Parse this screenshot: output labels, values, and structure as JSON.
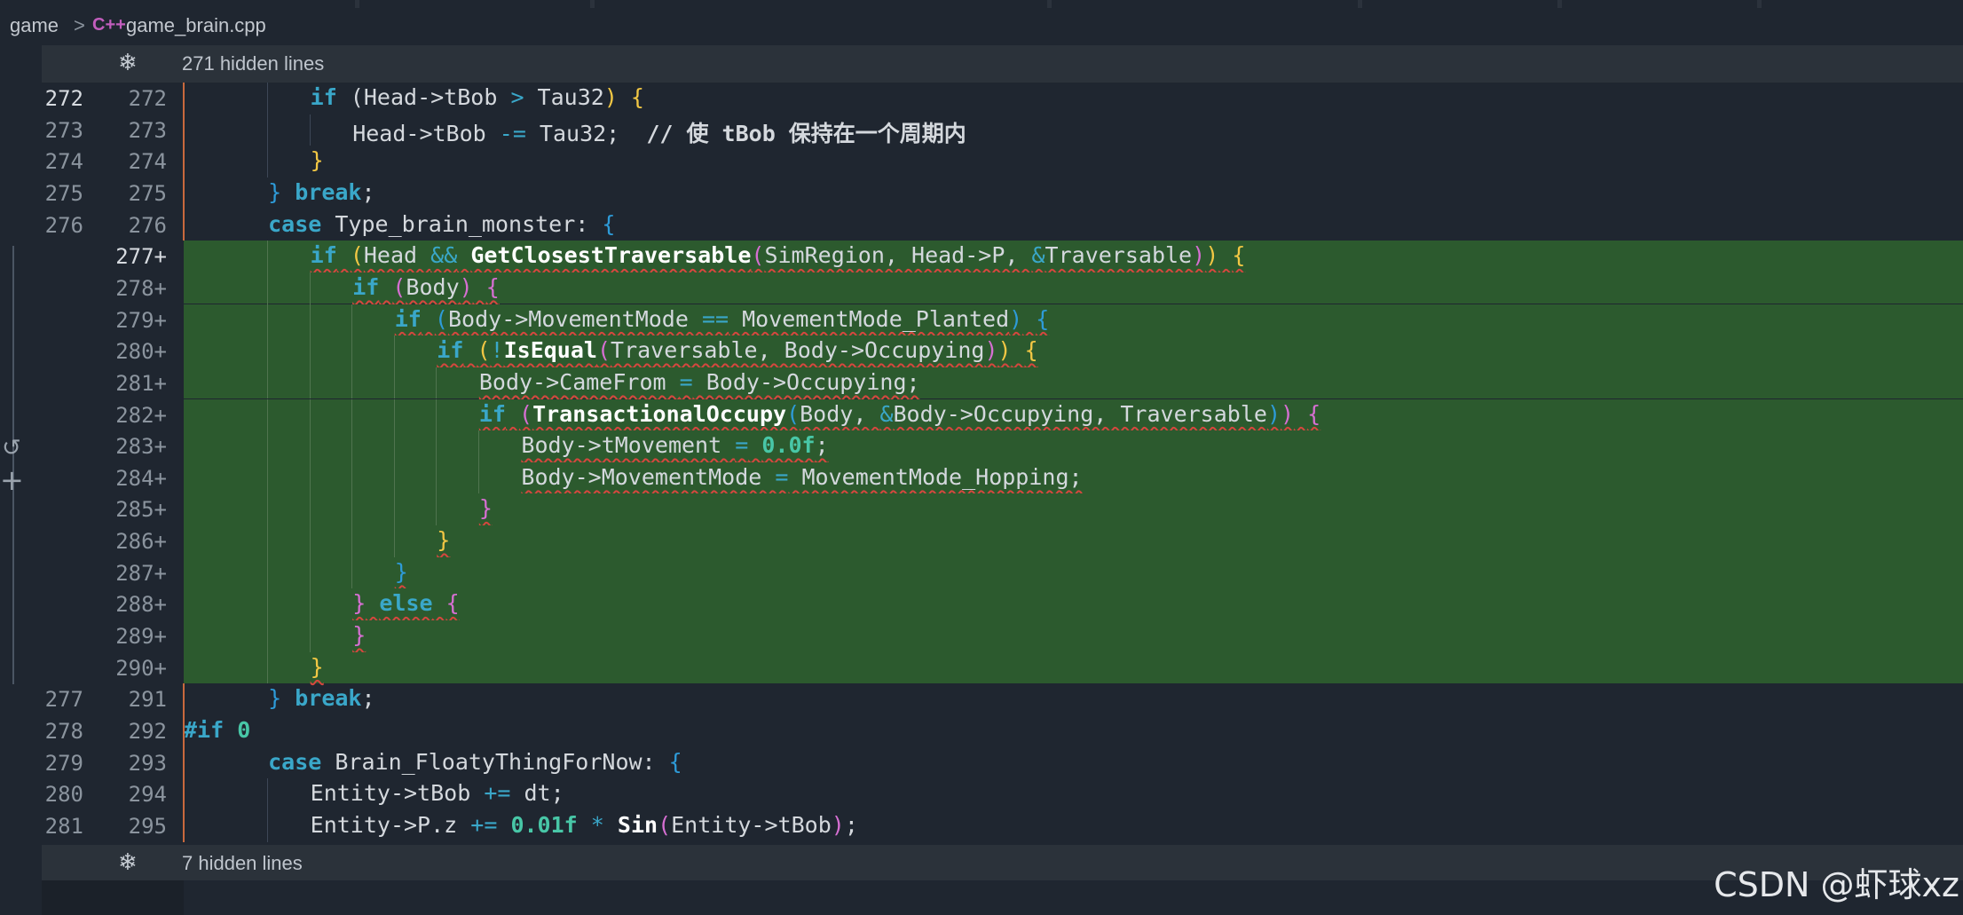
{
  "breadcrumb": {
    "folder": "game",
    "separator": ">",
    "file_icon": "C++",
    "file": "game_brain.cpp"
  },
  "hidden_top": {
    "icon": "fold-icon",
    "label": "271 hidden lines"
  },
  "hidden_bottom": {
    "icon": "fold-icon",
    "label": "7 hidden lines"
  },
  "watermark": "CSDN @虾球xz",
  "gutter_icons": {
    "revert": "↺",
    "add": "+"
  },
  "lines": [
    {
      "old": "272",
      "new": "272"
    },
    {
      "old": "273",
      "new": "273"
    },
    {
      "old": "274",
      "new": "274"
    },
    {
      "old": "275",
      "new": "275"
    },
    {
      "old": "276",
      "new": "276"
    },
    {
      "old": "",
      "new": "277+"
    },
    {
      "old": "",
      "new": "278+"
    },
    {
      "old": "",
      "new": "279+"
    },
    {
      "old": "",
      "new": "280+"
    },
    {
      "old": "",
      "new": "281+"
    },
    {
      "old": "",
      "new": "282+"
    },
    {
      "old": "",
      "new": "283+"
    },
    {
      "old": "",
      "new": "284+"
    },
    {
      "old": "",
      "new": "285+"
    },
    {
      "old": "",
      "new": "286+"
    },
    {
      "old": "",
      "new": "287+"
    },
    {
      "old": "",
      "new": "288+"
    },
    {
      "old": "",
      "new": "289+"
    },
    {
      "old": "",
      "new": "290+"
    },
    {
      "old": "277",
      "new": "291"
    },
    {
      "old": "278",
      "new": "292"
    },
    {
      "old": "279",
      "new": "293"
    },
    {
      "old": "280",
      "new": "294"
    },
    {
      "old": "281",
      "new": "295"
    }
  ],
  "code": {
    "l0": [
      "if",
      " (",
      "Head->tBob ",
      ">",
      " Tau32",
      ")",
      " {"
    ],
    "l1": [
      "Head->tBob ",
      "-=",
      " Tau32;  ",
      "// 使 tBob 保持在一个周期内"
    ],
    "l2": [
      "}"
    ],
    "l3": [
      "}",
      " ",
      "break",
      ";"
    ],
    "l4": [
      "case",
      " Type_brain_monster: ",
      "{"
    ],
    "l5": [
      "if",
      " ",
      "(",
      "Head ",
      "&&",
      " ",
      "GetClosestTraversable",
      "(",
      "SimRegion, Head->P, ",
      "&",
      "Traversable",
      ")",
      ")",
      " ",
      "{"
    ],
    "l6": [
      "if",
      " ",
      "(",
      "Body",
      ")",
      " ",
      "{"
    ],
    "l7": [
      "if",
      " ",
      "(",
      "Body->MovementMode ",
      "==",
      " MovementMode_Planted",
      ")",
      " ",
      "{"
    ],
    "l8": [
      "if",
      " ",
      "(",
      "!",
      "IsEqual",
      "(",
      "Traversable, Body->Occupying",
      ")",
      ")",
      " ",
      "{"
    ],
    "l9": [
      "Body->CameFrom ",
      "=",
      " Body->Occupying;"
    ],
    "l10": [
      "if",
      " ",
      "(",
      "TransactionalOccupy",
      "(",
      "Body, ",
      "&",
      "Body->Occupying, Traversable",
      ")",
      ")",
      " ",
      "{"
    ],
    "l11": [
      "Body->tMovement ",
      "=",
      " ",
      "0.0",
      "f",
      ";"
    ],
    "l12": [
      "Body->MovementMode ",
      "=",
      " MovementMode_Hopping;"
    ],
    "l13": [
      "}"
    ],
    "l14": [
      "}"
    ],
    "l15": [
      "}"
    ],
    "l16": [
      "}",
      " ",
      "else",
      " ",
      "{"
    ],
    "l17": [
      "}"
    ],
    "l18": [
      "}"
    ],
    "l19": [
      "}",
      " ",
      "break",
      ";"
    ],
    "l20": [
      "#if",
      " ",
      "0"
    ],
    "l21": [
      "case",
      " Brain_FloatyThingForNow: ",
      "{"
    ],
    "l22": [
      "Entity->tBob ",
      "+=",
      " dt;"
    ],
    "l23": [
      "Entity->P.z ",
      "+=",
      " ",
      "0.01",
      "f",
      " ",
      "*",
      " ",
      "Sin",
      "(",
      "Entity->tBob",
      ")",
      ";"
    ]
  }
}
